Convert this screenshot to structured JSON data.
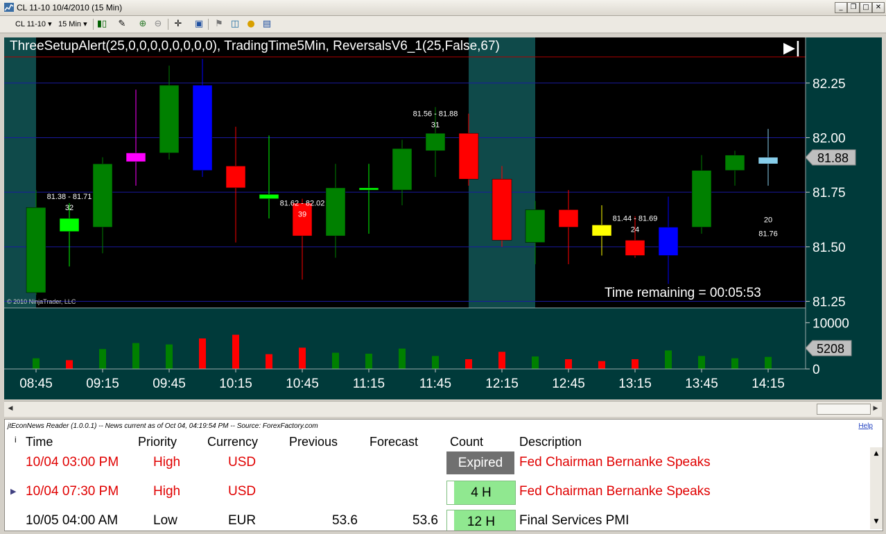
{
  "window": {
    "title": "CL 11-10  10/4/2010 (15 Min)"
  },
  "toolbar": {
    "instrument": "CL 11-10",
    "interval": "15 Min",
    "icons": [
      "bar-style-icon",
      "draw-pencil-icon",
      "zoom-in-icon",
      "zoom-out-icon",
      "crosshair-icon",
      "data-box-icon",
      "strategy-icon",
      "indicator-icon",
      "money-icon",
      "properties-icon"
    ]
  },
  "chart": {
    "header": "ThreeSetupAlert(25,0,0,0,0,0,0,0,0), TradingTime5Min, ReversalsV6_1(25,False,67)",
    "copyright": "© 2010 NinjaTrader, LLC",
    "time_remaining": "Time remaining = 00:05:53",
    "last_price": "81.88",
    "last_volume": "5208",
    "end_symbol": "▶|",
    "colors": {
      "background": "#000000",
      "panel": "#003a3a",
      "up": "#008000",
      "down": "#ff0000"
    }
  },
  "chart_data": {
    "type": "candlestick",
    "ylim": [
      81.22,
      82.37
    ],
    "y_ticks": [
      "82.25",
      "82.00",
      "81.75",
      "81.50",
      "81.25"
    ],
    "y_tick_values": [
      82.25,
      82.0,
      81.75,
      81.5,
      81.25
    ],
    "x_ticks": [
      "08:45",
      "09:15",
      "09:45",
      "10:15",
      "10:45",
      "11:15",
      "11:45",
      "12:15",
      "12:45",
      "13:15",
      "13:45",
      "14:15"
    ],
    "volume_ylim": [
      0,
      12000
    ],
    "volume_ticks": [
      "10000",
      "0"
    ],
    "volume_tick_values": [
      10000,
      0
    ],
    "candles": [
      {
        "time": "08:45",
        "o": 81.29,
        "h": 81.76,
        "l": 81.28,
        "c": 81.68,
        "color": "#008000"
      },
      {
        "time": "09:00",
        "o": 81.63,
        "h": 81.7,
        "l": 81.41,
        "c": 81.57,
        "color": "#00ff00"
      },
      {
        "time": "09:15",
        "o": 81.59,
        "h": 81.91,
        "l": 81.47,
        "c": 81.88,
        "color": "#008000"
      },
      {
        "time": "09:30",
        "o": 81.89,
        "h": 82.22,
        "l": 81.78,
        "c": 81.93,
        "color": "#ff00ff"
      },
      {
        "time": "09:45",
        "o": 81.93,
        "h": 82.33,
        "l": 81.9,
        "c": 82.24,
        "color": "#008000"
      },
      {
        "time": "10:00",
        "o": 82.24,
        "h": 82.36,
        "l": 81.82,
        "c": 81.85,
        "color": "#0000ff"
      },
      {
        "time": "10:15",
        "o": 81.87,
        "h": 82.05,
        "l": 81.52,
        "c": 81.77,
        "color": "#ff0000"
      },
      {
        "time": "10:30",
        "o": 81.74,
        "h": 82.01,
        "l": 81.63,
        "c": 81.72,
        "color": "#00ff00"
      },
      {
        "time": "10:45",
        "o": 81.7,
        "h": 81.72,
        "l": 81.35,
        "c": 81.55,
        "color": "#ff0000"
      },
      {
        "time": "11:00",
        "o": 81.55,
        "h": 81.88,
        "l": 81.45,
        "c": 81.77,
        "color": "#008000"
      },
      {
        "time": "11:15",
        "o": 81.76,
        "h": 81.88,
        "l": 81.56,
        "c": 81.77,
        "color": "#00ff00"
      },
      {
        "time": "11:30",
        "o": 81.76,
        "h": 81.99,
        "l": 81.69,
        "c": 81.95,
        "color": "#008000"
      },
      {
        "time": "11:45",
        "o": 81.94,
        "h": 82.14,
        "l": 81.82,
        "c": 82.02,
        "color": "#008000"
      },
      {
        "time": "12:00",
        "o": 82.02,
        "h": 82.11,
        "l": 81.78,
        "c": 81.81,
        "color": "#ff0000"
      },
      {
        "time": "12:15",
        "o": 81.81,
        "h": 81.87,
        "l": 81.5,
        "c": 81.53,
        "color": "#ff0000"
      },
      {
        "time": "12:30",
        "o": 81.52,
        "h": 81.71,
        "l": 81.42,
        "c": 81.67,
        "color": "#008000"
      },
      {
        "time": "12:45",
        "o": 81.67,
        "h": 81.76,
        "l": 81.42,
        "c": 81.59,
        "color": "#ff0000"
      },
      {
        "time": "13:00",
        "o": 81.6,
        "h": 81.69,
        "l": 81.46,
        "c": 81.55,
        "color": "#ffff00"
      },
      {
        "time": "13:15",
        "o": 81.53,
        "h": 81.64,
        "l": 81.45,
        "c": 81.46,
        "color": "#ff0000"
      },
      {
        "time": "13:30",
        "o": 81.46,
        "h": 81.73,
        "l": 81.33,
        "c": 81.59,
        "color": "#0000ff"
      },
      {
        "time": "13:45",
        "o": 81.59,
        "h": 81.92,
        "l": 81.56,
        "c": 81.85,
        "color": "#008000"
      },
      {
        "time": "14:00",
        "o": 81.85,
        "h": 81.94,
        "l": 81.78,
        "c": 81.92,
        "color": "#008000"
      },
      {
        "time": "14:15",
        "o": 81.88,
        "h": 82.04,
        "l": 81.78,
        "c": 81.91,
        "color": "#87ceeb"
      }
    ],
    "volume": [
      2300,
      1900,
      4300,
      5600,
      5300,
      6600,
      7400,
      3200,
      4600,
      3500,
      3300,
      4400,
      2800,
      2100,
      3700,
      2700,
      2100,
      1700,
      2100,
      4000,
      2800,
      2300,
      2600
    ],
    "shaded_sessions": [
      {
        "from": "08:30",
        "to": "08:45"
      },
      {
        "from": "12:00",
        "to": "12:30"
      }
    ],
    "annotations": [
      {
        "time": "09:00",
        "range": "81.38 - 81.71",
        "count": "32",
        "price": 81.7
      },
      {
        "time": "10:45",
        "range": "81.62 - 82.02",
        "count": "39",
        "price": 81.67
      },
      {
        "time": "11:45",
        "range": "81.56 - 81.88",
        "count": "31",
        "price": 82.08
      },
      {
        "time": "13:15",
        "range": "81.44 - 81.69",
        "count": "24",
        "price": 81.6
      },
      {
        "time": "14:15",
        "range": "81.76",
        "count": "20",
        "price": 81.65
      }
    ]
  },
  "news": {
    "header": "jtEconNews Reader (1.0.0.1)  --  News current as of Oct 04, 04:19:54 PM  --  Source: ForexFactory.com",
    "help": "Help",
    "columns": [
      "i",
      "Time",
      "Priority",
      "Currency",
      "Previous",
      "Forecast",
      "Count",
      "Description"
    ],
    "rows": [
      {
        "time": "10/04 03:00 PM",
        "priority": "High",
        "currency": "USD",
        "previous": "",
        "forecast": "",
        "count": "Expired",
        "description": "Fed Chairman Bernanke Speaks",
        "color": "#e00000",
        "count_style": "expired",
        "marker": ""
      },
      {
        "time": "10/04 07:30 PM",
        "priority": "High",
        "currency": "USD",
        "previous": "",
        "forecast": "",
        "count": "4 H",
        "description": "Fed Chairman Bernanke Speaks",
        "color": "#e00000",
        "count_style": "green",
        "marker": "▶"
      },
      {
        "time": "10/05 04:00 AM",
        "priority": "Low",
        "currency": "EUR",
        "previous": "53.6",
        "forecast": "53.6",
        "count": "12 H",
        "description": "Final Services PMI",
        "color": "#000000",
        "count_style": "green",
        "marker": ""
      }
    ]
  }
}
